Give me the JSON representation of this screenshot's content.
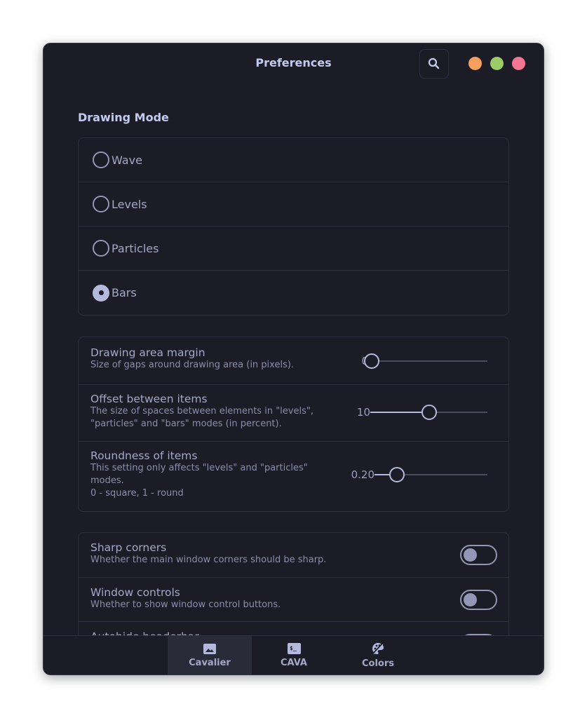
{
  "window": {
    "title": "Preferences",
    "controls": [
      {
        "name": "minimize",
        "color": "#f5a05e"
      },
      {
        "name": "maximize",
        "color": "#9ccc65"
      },
      {
        "name": "close",
        "color": "#f27591"
      }
    ]
  },
  "drawing_mode": {
    "title": "Drawing Mode",
    "options": [
      {
        "label": "Wave",
        "checked": false
      },
      {
        "label": "Levels",
        "checked": false
      },
      {
        "label": "Particles",
        "checked": false
      },
      {
        "label": "Bars",
        "checked": true
      }
    ]
  },
  "sliders": [
    {
      "title": "Drawing area margin",
      "subtitle": "Size of gaps around drawing area (in pixels).",
      "value_label": "0",
      "fraction": 0.0
    },
    {
      "title": "Offset between items",
      "subtitle": "The size of spaces between elements in \"levels\", \"particles\" and \"bars\" modes (in percent).",
      "value_label": "10",
      "fraction": 0.5
    },
    {
      "title": "Roundness of items",
      "subtitle": "This setting only affects \"levels\" and \"particles\" modes.\n0 - square, 1 - round",
      "value_label": "0.20",
      "fraction": 0.2
    }
  ],
  "switches": [
    {
      "title": "Sharp corners",
      "subtitle": "Whether the main window corners should be sharp.",
      "on": false
    },
    {
      "title": "Window controls",
      "subtitle": "Whether to show window control buttons.",
      "on": false
    },
    {
      "title": "Autohide headerbar",
      "subtitle": "",
      "on": false
    }
  ],
  "tabs": [
    {
      "label": "Cavalier",
      "icon": "image-icon",
      "active": true
    },
    {
      "label": "CAVA",
      "icon": "terminal-icon",
      "active": false
    },
    {
      "label": "Colors",
      "icon": "palette-icon",
      "active": false
    }
  ]
}
